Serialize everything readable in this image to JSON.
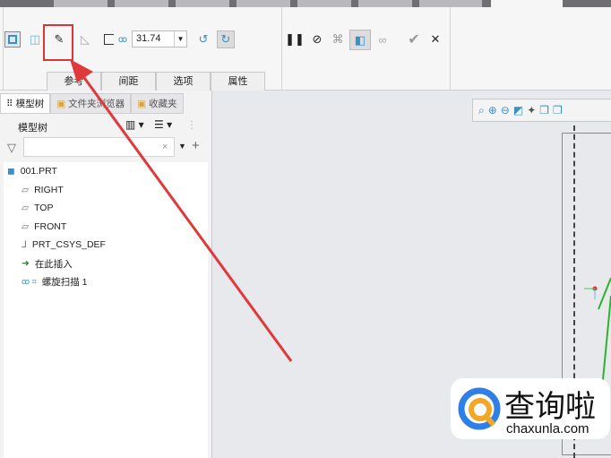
{
  "ribbon": {
    "thickness_value": "31.74",
    "dashboard_tabs": [
      "参考",
      "间距",
      "选项",
      "属性"
    ],
    "icons_left": [
      "solid-icon",
      "surface-icon",
      "sketch-edit-icon",
      "remove-material-icon",
      "thicken-icon",
      "pitch-icon"
    ],
    "icons_right": [
      "pause-icon",
      "no-preview-icon",
      "geometry-preview-icon",
      "preview-icon",
      "verify-icon",
      "ok-icon",
      "cancel-icon"
    ]
  },
  "panel": {
    "tabs": [
      "模型树",
      "文件夹浏览器",
      "收藏夹"
    ],
    "title": "模型树",
    "filter_placeholder": "",
    "tree": [
      {
        "label": "001.PRT",
        "icon": "part-icon"
      },
      {
        "label": "RIGHT",
        "icon": "datum-plane-icon"
      },
      {
        "label": "TOP",
        "icon": "datum-plane-icon"
      },
      {
        "label": "FRONT",
        "icon": "datum-plane-icon"
      },
      {
        "label": "PRT_CSYS_DEF",
        "icon": "csys-icon"
      },
      {
        "label": "在此插入",
        "icon": "insert-arrow-icon"
      },
      {
        "label": "螺旋扫描 1",
        "icon": "helical-sweep-icon"
      }
    ]
  },
  "watermark": {
    "brand": "查询啦",
    "domain": "chaxunla.com"
  },
  "colors": {
    "accent": "#3a8fc4",
    "highlight": "#d8363a"
  }
}
